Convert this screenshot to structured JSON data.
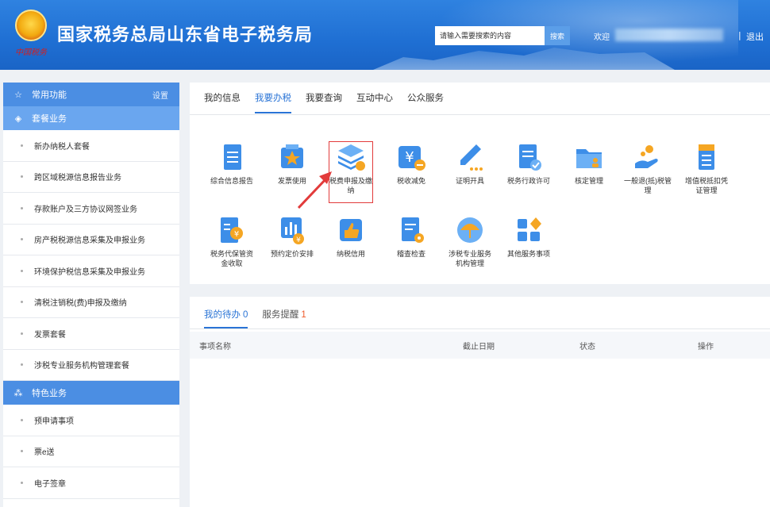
{
  "header": {
    "title": "国家税务总局山东省电子税务局",
    "logo_seal_text": "中国税务",
    "search_placeholder": "请输入需要搜索的内容",
    "search_button": "搜索",
    "welcome": "欢迎",
    "divider": "|",
    "logout": "退出"
  },
  "sidebar": {
    "common": {
      "label": "常用功能",
      "setting": "设置"
    },
    "package": {
      "label": "套餐业务"
    },
    "package_items": [
      "新办纳税人套餐",
      "跨区域税源信息报告业务",
      "存款账户及三方协议网签业务",
      "房产税税源信息采集及申报业务",
      "环境保护税信息采集及申报业务",
      "清税注销税(费)申报及缴纳",
      "发票套餐",
      "涉税专业服务机构管理套餐"
    ],
    "special": {
      "label": "特色业务"
    },
    "special_items": [
      "预申请事项",
      "票e送",
      "电子签章"
    ]
  },
  "main": {
    "tabs": [
      "我的信息",
      "我要办税",
      "我要查询",
      "互动中心",
      "公众服务"
    ],
    "active_tab": 1,
    "functions_row1": [
      {
        "label": "综合信息报告",
        "icon": "document-list-icon",
        "color": "#3d8ee8"
      },
      {
        "label": "发票使用",
        "icon": "invoice-star-icon",
        "color": "#3d8ee8"
      },
      {
        "label": "税费申报及缴纳",
        "icon": "layers-coin-icon",
        "color": "#3d8ee8"
      },
      {
        "label": "税收减免",
        "icon": "yuan-minus-icon",
        "color": "#3d8ee8"
      },
      {
        "label": "证明开具",
        "icon": "pen-icon",
        "color": "#3d8ee8"
      },
      {
        "label": "税务行政许可",
        "icon": "document-check-icon",
        "color": "#3d8ee8"
      },
      {
        "label": "核定管理",
        "icon": "folder-user-icon",
        "color": "#3d8ee8"
      },
      {
        "label": "一般退(抵)税管理",
        "icon": "hand-coin-icon",
        "color": "#3d8ee8"
      },
      {
        "label": "增值税抵扣凭证管理",
        "icon": "receipt-icon",
        "color": "#3d8ee8"
      }
    ],
    "functions_row2": [
      {
        "label": "税务代保管资金收取",
        "icon": "document-coin-icon"
      },
      {
        "label": "预约定价安排",
        "icon": "chart-yuan-icon"
      },
      {
        "label": "纳税信用",
        "icon": "thumbs-up-icon"
      },
      {
        "label": "稽查检查",
        "icon": "document-eye-icon"
      },
      {
        "label": "涉税专业服务机构管理",
        "icon": "umbrella-icon"
      },
      {
        "label": "其他服务事项",
        "icon": "grid-apps-icon"
      }
    ],
    "accent_color": "#2a74d6",
    "highlight_color": "#e23b3b"
  },
  "todo": {
    "tabs": [
      {
        "label": "我的待办",
        "count": "0"
      },
      {
        "label": "服务提醒",
        "count": "1"
      }
    ],
    "columns": [
      "事项名称",
      "截止日期",
      "状态",
      "操作"
    ]
  }
}
